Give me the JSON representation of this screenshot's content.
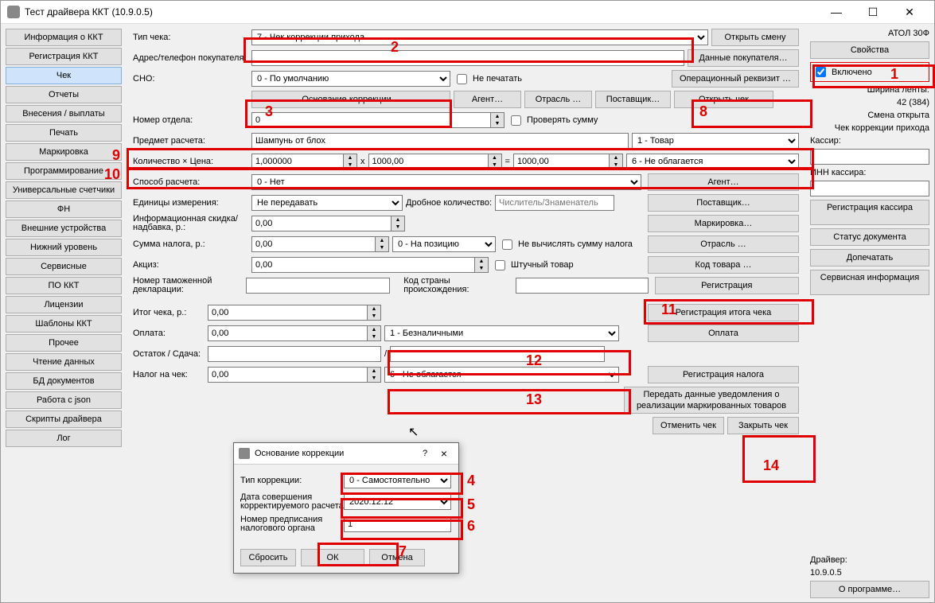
{
  "window_title": "Тест драйвера ККТ (10.9.0.5)",
  "sidebar": {
    "items": [
      "Информация о ККТ",
      "Регистрация ККТ",
      "Чек",
      "Отчеты",
      "Внесения / выплаты",
      "Печать",
      "Маркировка",
      "Программирование",
      "Универсальные счетчики",
      "ФН",
      "Внешние устройства",
      "Нижний уровень",
      "Сервисные",
      "ПО ККТ",
      "Лицензии",
      "Шаблоны ККТ",
      "Прочее",
      "Чтение данных",
      "БД документов",
      "Работа с json",
      "Скрипты драйвера",
      "Лог"
    ],
    "active": "Чек"
  },
  "labels": {
    "type_check": "Тип чека:",
    "address": "Адрес/телефон покупателя:",
    "sno": "СНО:",
    "dept_no": "Номер отдела:",
    "subject": "Предмет расчета:",
    "qty_price": "Количество × Цена:",
    "pay_method": "Способ расчета:",
    "units": "Единицы измерения:",
    "info_discount": "Информационная скидка/надбавка, р.:",
    "tax_sum": "Сумма налога, р.:",
    "excise": "Акциз:",
    "customs_decl": "Номер таможенной декларации:",
    "origin_country": "Код страны происхождения:",
    "total": "Итог чека, р.:",
    "payment": "Оплата:",
    "balance": "Остаток / Сдача:",
    "tax_on_check": "Налог на чек:",
    "fractional_qty": "Дробное количество:"
  },
  "values": {
    "type_check": "7 - Чек коррекции прихода",
    "sno": "0 - По умолчанию",
    "dept_no": "0",
    "subject": "Шампунь от блох",
    "subject_type": "1 - Товар",
    "qty": "1,000000",
    "price": "1000,00",
    "sum": "1000,00",
    "vat": "6 - Не облагается",
    "pay_method": "0 - Нет",
    "units": "Не передавать",
    "fractional_ph": "Числитель/Знаменатель",
    "info_discount": "0,00",
    "tax_sum": "0,00",
    "tax_pos": "0 - На позицию",
    "excise": "0,00",
    "total": "0,00",
    "payment": "0,00",
    "payment_type": "1 - Безналичными",
    "tax_on_check": "0,00",
    "tax_on_check_val": "6 - Не облагается",
    "x": "x",
    "eq": "=",
    "slash": "/"
  },
  "checkboxes": {
    "no_print": "Не печатать",
    "check_sum": "Проверять сумму",
    "no_calc_tax": "Не вычислять сумму налога",
    "piece_goods": "Штучный товар",
    "enabled": "Включено"
  },
  "buttons": {
    "open_shift": "Открыть смену",
    "buyer_data": "Данные покупателя…",
    "oper_req": "Операционный реквизит …",
    "basis_corr": "Основание коррекции…",
    "agent": "Агент…",
    "industry": "Отрасль …",
    "supplier": "Поставщик…",
    "open_check": "Открыть чек",
    "agent2": "Агент…",
    "supplier2": "Поставщик…",
    "marking": "Маркировка…",
    "industry2": "Отрасль …",
    "product_code": "Код товара …",
    "registration": "Регистрация",
    "reg_total": "Регистрация итога чека",
    "pay": "Оплата",
    "reg_tax": "Регистрация налога",
    "send_marking": "Передать данные уведомления о реализации маркированных товаров",
    "cancel_check": "Отменить чек",
    "close_check": "Закрыть чек"
  },
  "right": {
    "device": "АТОЛ 30Ф",
    "properties": "Свойства",
    "tape_width_lbl": "Ширина ленты:",
    "tape_width": "42 (384)",
    "shift_open": "Смена открыта",
    "check_type": "Чек коррекции прихода",
    "cashier_lbl": "Кассир:",
    "cashier_inn_lbl": "ИНН кассира:",
    "reg_cashier": "Регистрация кассира",
    "doc_status": "Статус документа",
    "reprint": "Допечатать",
    "service_info": "Сервисная информация",
    "driver_lbl": "Драйвер:",
    "driver_ver": "10.9.0.5",
    "about": "О программе…"
  },
  "dialog": {
    "title": "Основание коррекции",
    "type_lbl": "Тип коррекции:",
    "type_val": "0 - Самостоятельно",
    "date_lbl": "Дата совершения корректируемого расчета",
    "date_val": "2020.12.12",
    "order_lbl": "Номер предписания налогового органа",
    "order_val": "1",
    "reset": "Сбросить",
    "ok": "ОК",
    "cancel": "Отмена",
    "help": "?",
    "close": "×"
  }
}
